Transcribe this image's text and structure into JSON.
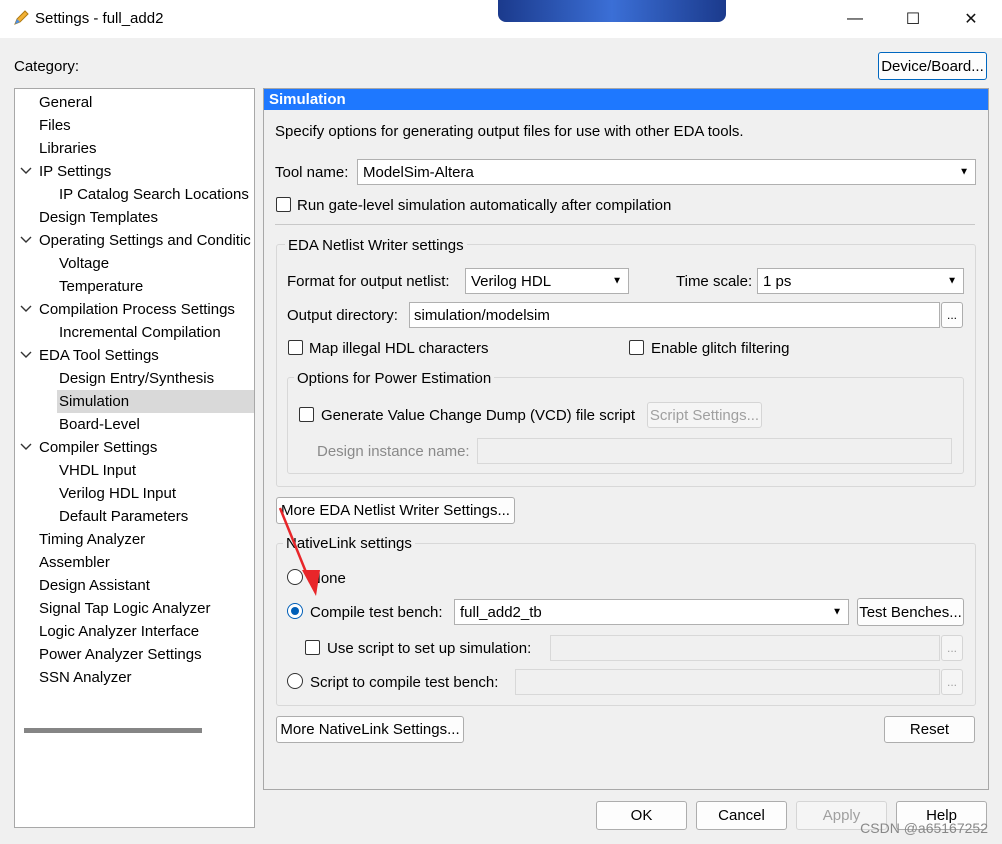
{
  "window": {
    "title": "Settings - full_add2",
    "category_label": "Category:",
    "device_board_button": "Device/Board...",
    "minimize_glyph": "—",
    "maximize_glyph": "☐",
    "close_glyph": "✕"
  },
  "tree": {
    "items": [
      {
        "label": "General",
        "level": 0,
        "expandable": false
      },
      {
        "label": "Files",
        "level": 0,
        "expandable": false
      },
      {
        "label": "Libraries",
        "level": 0,
        "expandable": false
      },
      {
        "label": "IP Settings",
        "level": 0,
        "expandable": true
      },
      {
        "label": "IP Catalog Search Locations",
        "level": 1,
        "expandable": false
      },
      {
        "label": "Design Templates",
        "level": 0,
        "expandable": false
      },
      {
        "label": "Operating Settings and Conditic",
        "level": 0,
        "expandable": true
      },
      {
        "label": "Voltage",
        "level": 1,
        "expandable": false
      },
      {
        "label": "Temperature",
        "level": 1,
        "expandable": false
      },
      {
        "label": "Compilation Process Settings",
        "level": 0,
        "expandable": true
      },
      {
        "label": "Incremental Compilation",
        "level": 1,
        "expandable": false
      },
      {
        "label": "EDA Tool Settings",
        "level": 0,
        "expandable": true
      },
      {
        "label": "Design Entry/Synthesis",
        "level": 1,
        "expandable": false
      },
      {
        "label": "Simulation",
        "level": 1,
        "expandable": false,
        "selected": true
      },
      {
        "label": "Board-Level",
        "level": 1,
        "expandable": false
      },
      {
        "label": "Compiler Settings",
        "level": 0,
        "expandable": true
      },
      {
        "label": "VHDL Input",
        "level": 1,
        "expandable": false
      },
      {
        "label": "Verilog HDL Input",
        "level": 1,
        "expandable": false
      },
      {
        "label": "Default Parameters",
        "level": 1,
        "expandable": false
      },
      {
        "label": "Timing Analyzer",
        "level": 0,
        "expandable": false
      },
      {
        "label": "Assembler",
        "level": 0,
        "expandable": false
      },
      {
        "label": "Design Assistant",
        "level": 0,
        "expandable": false
      },
      {
        "label": "Signal Tap Logic Analyzer",
        "level": 0,
        "expandable": false
      },
      {
        "label": "Logic Analyzer Interface",
        "level": 0,
        "expandable": false
      },
      {
        "label": "Power Analyzer Settings",
        "level": 0,
        "expandable": false
      },
      {
        "label": "SSN Analyzer",
        "level": 0,
        "expandable": false
      }
    ]
  },
  "simulation": {
    "header": "Simulation",
    "description": "Specify options for generating output files for use with other EDA tools.",
    "tool_name_label": "Tool name:",
    "tool_name_value": "ModelSim-Altera",
    "run_gate_level_label": "Run gate-level simulation automatically after compilation",
    "netlist_group_title": "EDA Netlist Writer settings",
    "format_label": "Format for output netlist:",
    "format_value": "Verilog HDL",
    "time_scale_label": "Time scale:",
    "time_scale_value": "1 ps",
    "output_dir_label": "Output directory:",
    "output_dir_value": "simulation/modelsim",
    "browse_label": "...",
    "map_illegal_label": "Map illegal HDL characters",
    "glitch_label": "Enable glitch filtering",
    "power_group_title": "Options for Power Estimation",
    "vcd_label": "Generate Value Change Dump (VCD) file script",
    "script_settings_button": "Script Settings...",
    "design_instance_label": "Design instance name:",
    "more_netlist_button": "More EDA Netlist Writer Settings...",
    "nativelink_group_title": "NativeLink settings",
    "none_label": "None",
    "compile_tb_label": "Compile test bench:",
    "compile_tb_value": "full_add2_tb",
    "test_benches_button": "Test Benches...",
    "use_script_label": "Use script to set up simulation:",
    "script_compile_label": "Script to compile test bench:",
    "more_nativelink_button": "More NativeLink Settings...",
    "reset_button": "Reset"
  },
  "footer": {
    "ok": "OK",
    "cancel": "Cancel",
    "apply": "Apply",
    "help": "Help"
  },
  "watermark": "CSDN @a65167252",
  "colors": {
    "header_blue": "#1e78ff",
    "radio_accent": "#005fb8",
    "arrow_red": "#e8262a"
  }
}
